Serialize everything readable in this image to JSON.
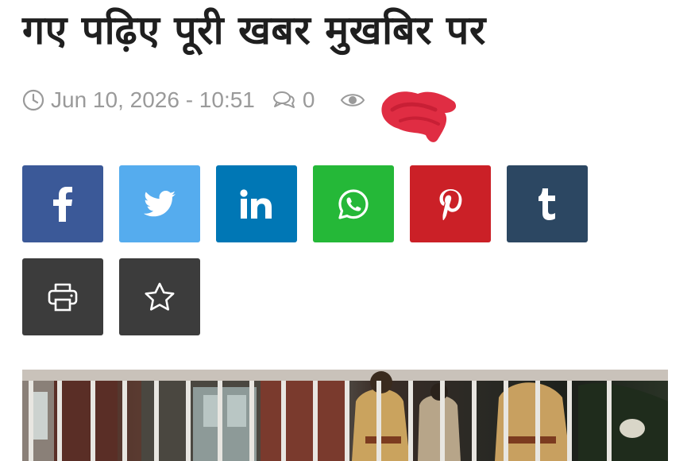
{
  "article": {
    "title": "गए पढ़िए पूरी खबर मुखबिर पर"
  },
  "meta": {
    "date_time": "Jun 10, 2026 - 10:51",
    "comments_count": "0",
    "icons": [
      "clock-icon",
      "comments-icon",
      "eye-icon"
    ]
  },
  "share_buttons": [
    {
      "name": "facebook",
      "icon": "facebook-icon",
      "color": "#3b5998"
    },
    {
      "name": "twitter",
      "icon": "twitter-icon",
      "color": "#55acee"
    },
    {
      "name": "linkedin",
      "icon": "linkedin-icon",
      "color": "#0077b5"
    },
    {
      "name": "whatsapp",
      "icon": "whatsapp-icon",
      "color": "#25b838"
    },
    {
      "name": "pinterest",
      "icon": "pinterest-icon",
      "color": "#cb2027"
    },
    {
      "name": "tumblr",
      "icon": "tumblr-icon",
      "color": "#2c4762"
    },
    {
      "name": "print",
      "icon": "printer-icon",
      "color": "#3c3c3c"
    },
    {
      "name": "favorite",
      "icon": "star-icon",
      "color": "#3c3c3c"
    }
  ],
  "colors": {
    "meta_text": "#9a9a9a",
    "redaction": "#e02d43",
    "headline": "#1f1f1f"
  }
}
